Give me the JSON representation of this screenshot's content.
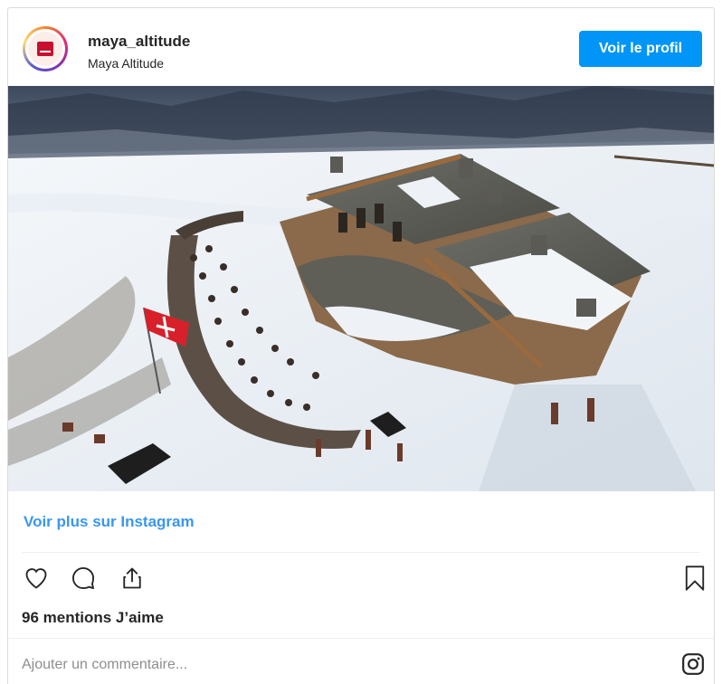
{
  "header": {
    "username": "maya_altitude",
    "full_name": "Maya Altitude",
    "profile_button_label": "Voir le profil",
    "avatar_icon": "maya-altitude-logo"
  },
  "post": {
    "image_description_icon": "photo-mountain-restaurant",
    "see_more_label": "Voir plus sur Instagram",
    "likes_text": "96 mentions J’aime",
    "comment_placeholder": "Ajouter un commentaire..."
  },
  "actions": {
    "like_icon": "heart-icon",
    "comment_icon": "comment-icon",
    "share_icon": "share-icon",
    "save_icon": "bookmark-icon",
    "instagram_icon": "instagram-icon"
  },
  "colors": {
    "accent": "#0095f6",
    "link": "#3897f0",
    "text": "#262626",
    "muted": "#8e8e8e",
    "border": "#dbdbdb"
  }
}
